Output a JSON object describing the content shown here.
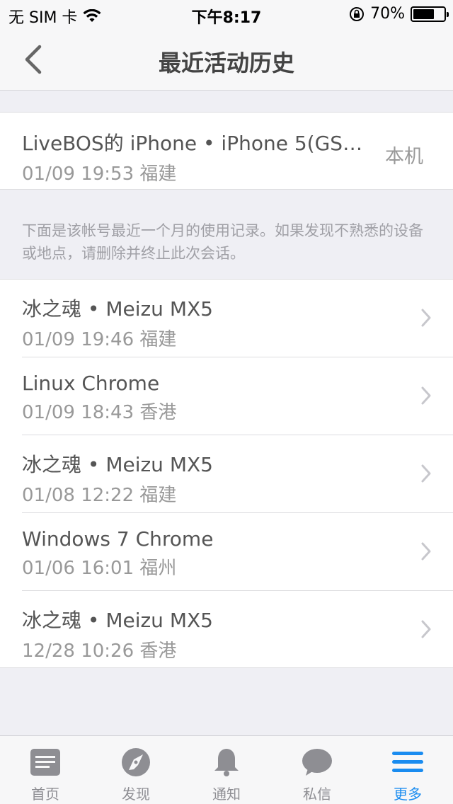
{
  "status_bar": {
    "carrier": "无 SIM 卡",
    "time": "下午8:17",
    "battery_percent": "70%",
    "battery_level": 0.7
  },
  "nav": {
    "title": "最近活动历史",
    "back_icon": "chevron-left-icon"
  },
  "current_device": {
    "title": "LiveBOS的 iPhone • iPhone 5(GSM...",
    "subtitle": "01/09 19:53 福建",
    "tag": "本机"
  },
  "notice": "下面是该帐号最近一个月的使用记录。如果发现不熟悉的设备或地点，请删除并终止此次会话。",
  "history": [
    {
      "title": "冰之魂 • Meizu MX5",
      "subtitle": "01/09 19:46 福建"
    },
    {
      "title": "Linux  Chrome",
      "subtitle": "01/09 18:43 香港"
    },
    {
      "title": "冰之魂 • Meizu MX5",
      "subtitle": "01/08 12:22 福建"
    },
    {
      "title": "Windows 7  Chrome",
      "subtitle": "01/06 16:01 福州"
    },
    {
      "title": "冰之魂 • Meizu MX5",
      "subtitle": "12/28 10:26 香港"
    }
  ],
  "tabs": [
    {
      "label": "首页",
      "icon": "home-icon"
    },
    {
      "label": "发现",
      "icon": "compass-icon"
    },
    {
      "label": "通知",
      "icon": "bell-icon"
    },
    {
      "label": "私信",
      "icon": "chat-bubble-icon"
    },
    {
      "label": "更多",
      "icon": "menu-icon",
      "active": true
    }
  ],
  "colors": {
    "accent": "#1a8cf0",
    "background": "#efeff4",
    "tab_inactive": "#8e8e93"
  }
}
